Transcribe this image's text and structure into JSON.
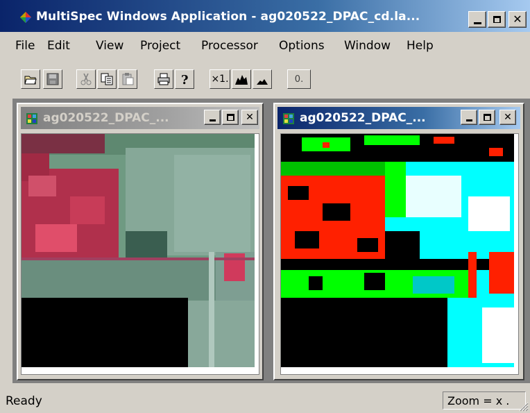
{
  "window": {
    "title": "MultiSpec Windows Application - ag020522_DPAC_cd.la...",
    "icon": "multispec-app-icon"
  },
  "menu": [
    {
      "label": "File"
    },
    {
      "label": "Edit"
    },
    {
      "label": "View"
    },
    {
      "label": "Project"
    },
    {
      "label": "Processor"
    },
    {
      "label": "Options"
    },
    {
      "label": "Window"
    },
    {
      "label": "Help"
    }
  ],
  "toolbar": [
    {
      "name": "open-folder-icon"
    },
    {
      "name": "save-icon"
    },
    {
      "name": "cut-icon"
    },
    {
      "name": "copy-icon"
    },
    {
      "name": "paste-icon"
    },
    {
      "name": "print-icon"
    },
    {
      "name": "help-icon"
    },
    {
      "name": "zoom-x1-icon",
      "label": "×1."
    },
    {
      "name": "zoom-in-icon"
    },
    {
      "name": "zoom-out-icon"
    },
    {
      "name": "overlay-dropdown-icon",
      "label": "0."
    }
  ],
  "child_windows": [
    {
      "title": "ag020522_DPAC_...",
      "active": false
    },
    {
      "title": "ag020522_DPAC_...",
      "active": true
    }
  ],
  "status": {
    "text": "Ready",
    "zoom": "Zoom = x ."
  },
  "colors": {
    "titlebar_active": "#0a246a",
    "titlebar_inactive": "#808080",
    "face": "#d4d0c8"
  }
}
